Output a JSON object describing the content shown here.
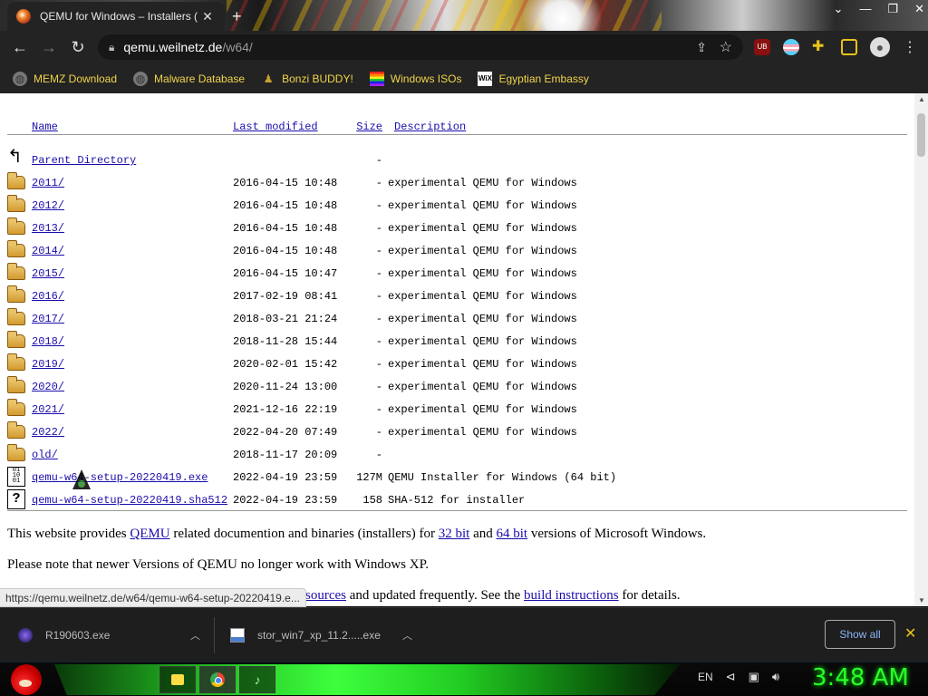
{
  "browser": {
    "tab_title": "QEMU for Windows – Installers (",
    "new_tab": "+",
    "url_host": "qemu.weilnetz.de",
    "url_path": "/w64/"
  },
  "bookmarks": [
    {
      "label": "MEMZ Download",
      "icon": "globe-icon"
    },
    {
      "label": "Malware Database",
      "icon": "globe-icon"
    },
    {
      "label": "Bonzi BUDDY!",
      "icon": "bonzi-icon"
    },
    {
      "label": "Windows ISOs",
      "icon": "rainbow-flag-icon"
    },
    {
      "label": "Egyptian Embassy",
      "icon": "wix-icon"
    }
  ],
  "wix_icon_text": "WiX",
  "listing": {
    "headers": {
      "name": "Name",
      "modified": "Last modified",
      "size": "Size",
      "description": "Description"
    },
    "rows": [
      {
        "icon": "back",
        "name": "Parent Directory",
        "date": "",
        "size": "-",
        "desc": ""
      },
      {
        "icon": "folder",
        "name": "2011/",
        "date": "2016-04-15 10:48",
        "size": "-",
        "desc": "experimental QEMU for Windows"
      },
      {
        "icon": "folder",
        "name": "2012/",
        "date": "2016-04-15 10:48",
        "size": "-",
        "desc": "experimental QEMU for Windows"
      },
      {
        "icon": "folder",
        "name": "2013/",
        "date": "2016-04-15 10:48",
        "size": "-",
        "desc": "experimental QEMU for Windows"
      },
      {
        "icon": "folder",
        "name": "2014/",
        "date": "2016-04-15 10:48",
        "size": "-",
        "desc": "experimental QEMU for Windows"
      },
      {
        "icon": "folder",
        "name": "2015/",
        "date": "2016-04-15 10:47",
        "size": "-",
        "desc": "experimental QEMU for Windows"
      },
      {
        "icon": "folder",
        "name": "2016/",
        "date": "2017-02-19 08:41",
        "size": "-",
        "desc": "experimental QEMU for Windows"
      },
      {
        "icon": "folder",
        "name": "2017/",
        "date": "2018-03-21 21:24",
        "size": "-",
        "desc": "experimental QEMU for Windows"
      },
      {
        "icon": "folder",
        "name": "2018/",
        "date": "2018-11-28 15:44",
        "size": "-",
        "desc": "experimental QEMU for Windows"
      },
      {
        "icon": "folder",
        "name": "2019/",
        "date": "2020-02-01 15:42",
        "size": "-",
        "desc": "experimental QEMU for Windows"
      },
      {
        "icon": "folder",
        "name": "2020/",
        "date": "2020-11-24 13:00",
        "size": "-",
        "desc": "experimental QEMU for Windows"
      },
      {
        "icon": "folder",
        "name": "2021/",
        "date": "2021-12-16 22:19",
        "size": "-",
        "desc": "experimental QEMU for Windows"
      },
      {
        "icon": "folder",
        "name": "2022/",
        "date": "2022-04-20 07:49",
        "size": "-",
        "desc": "experimental QEMU for Windows"
      },
      {
        "icon": "folder",
        "name": "old/",
        "date": "2018-11-17 20:09",
        "size": "-",
        "desc": ""
      },
      {
        "icon": "binary",
        "name": "qemu-w64-setup-20220419.exe",
        "date": "2022-04-19 23:59",
        "size": "127M",
        "desc": "QEMU Installer for Windows (64 bit)"
      },
      {
        "icon": "unknown",
        "name": "qemu-w64-setup-20220419.sha512",
        "date": "2022-04-19 23:59",
        "size": "158",
        "desc": "SHA-512 for installer"
      }
    ]
  },
  "binary_icon_text": "01\n10\n01",
  "unknown_icon_text": "?",
  "para1": {
    "t1": "This website provides ",
    "l1": "QEMU",
    "t2": " related documention and binaries (installers) for ",
    "l2": "32 bit",
    "t3": " and ",
    "l3": "64 bit",
    "t4": " versions of Microsoft Windows."
  },
  "para2": "Please note that newer Versions of QEMU no longer work with Windows XP.",
  "para3": {
    "l1": "sources",
    "t1": " and updated frequently. See the ",
    "l2": "build instructions",
    "t2": " for details."
  },
  "status_url": "https://qemu.weilnetz.de/w64/qemu-w64-setup-20220419.e...",
  "downloads": [
    {
      "name": "R190603.exe"
    },
    {
      "name": "stor_win7_xp_11.2.....exe"
    }
  ],
  "show_all": "Show all",
  "tray": {
    "lang": "EN"
  },
  "clock": "3:48 AM",
  "colors": {
    "link": "#1a0dab",
    "bookmark_text": "#f0d44a",
    "clock": "#2aff2a",
    "show_all": "#8ab4f8"
  }
}
